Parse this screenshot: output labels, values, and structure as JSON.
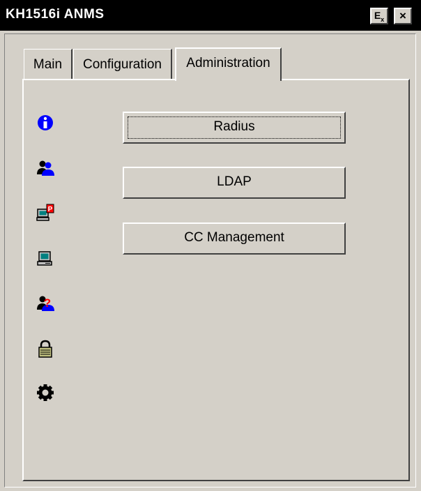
{
  "window": {
    "title": "KH1516i ANMS",
    "buttons": {
      "ex_label": "E",
      "ex_sub": "x",
      "close_label": "×"
    }
  },
  "tabs": [
    {
      "label": "Main"
    },
    {
      "label": "Configuration"
    },
    {
      "label": "Administration",
      "active": true
    }
  ],
  "side_icons": [
    {
      "name": "info-icon",
      "color": "#0000ff"
    },
    {
      "name": "user-group-icon",
      "color": "#0000ff"
    },
    {
      "name": "computer-alert-icon",
      "color": "#ff0000"
    },
    {
      "name": "computer-icon",
      "color": "#008080"
    },
    {
      "name": "user-question-icon",
      "color": "#ff0000"
    },
    {
      "name": "lock-icon",
      "color": "#808000"
    },
    {
      "name": "gear-icon",
      "color": "#000000"
    }
  ],
  "buttons": [
    {
      "label": "Radius",
      "focused": true
    },
    {
      "label": "LDAP"
    },
    {
      "label": "CC Management"
    }
  ]
}
